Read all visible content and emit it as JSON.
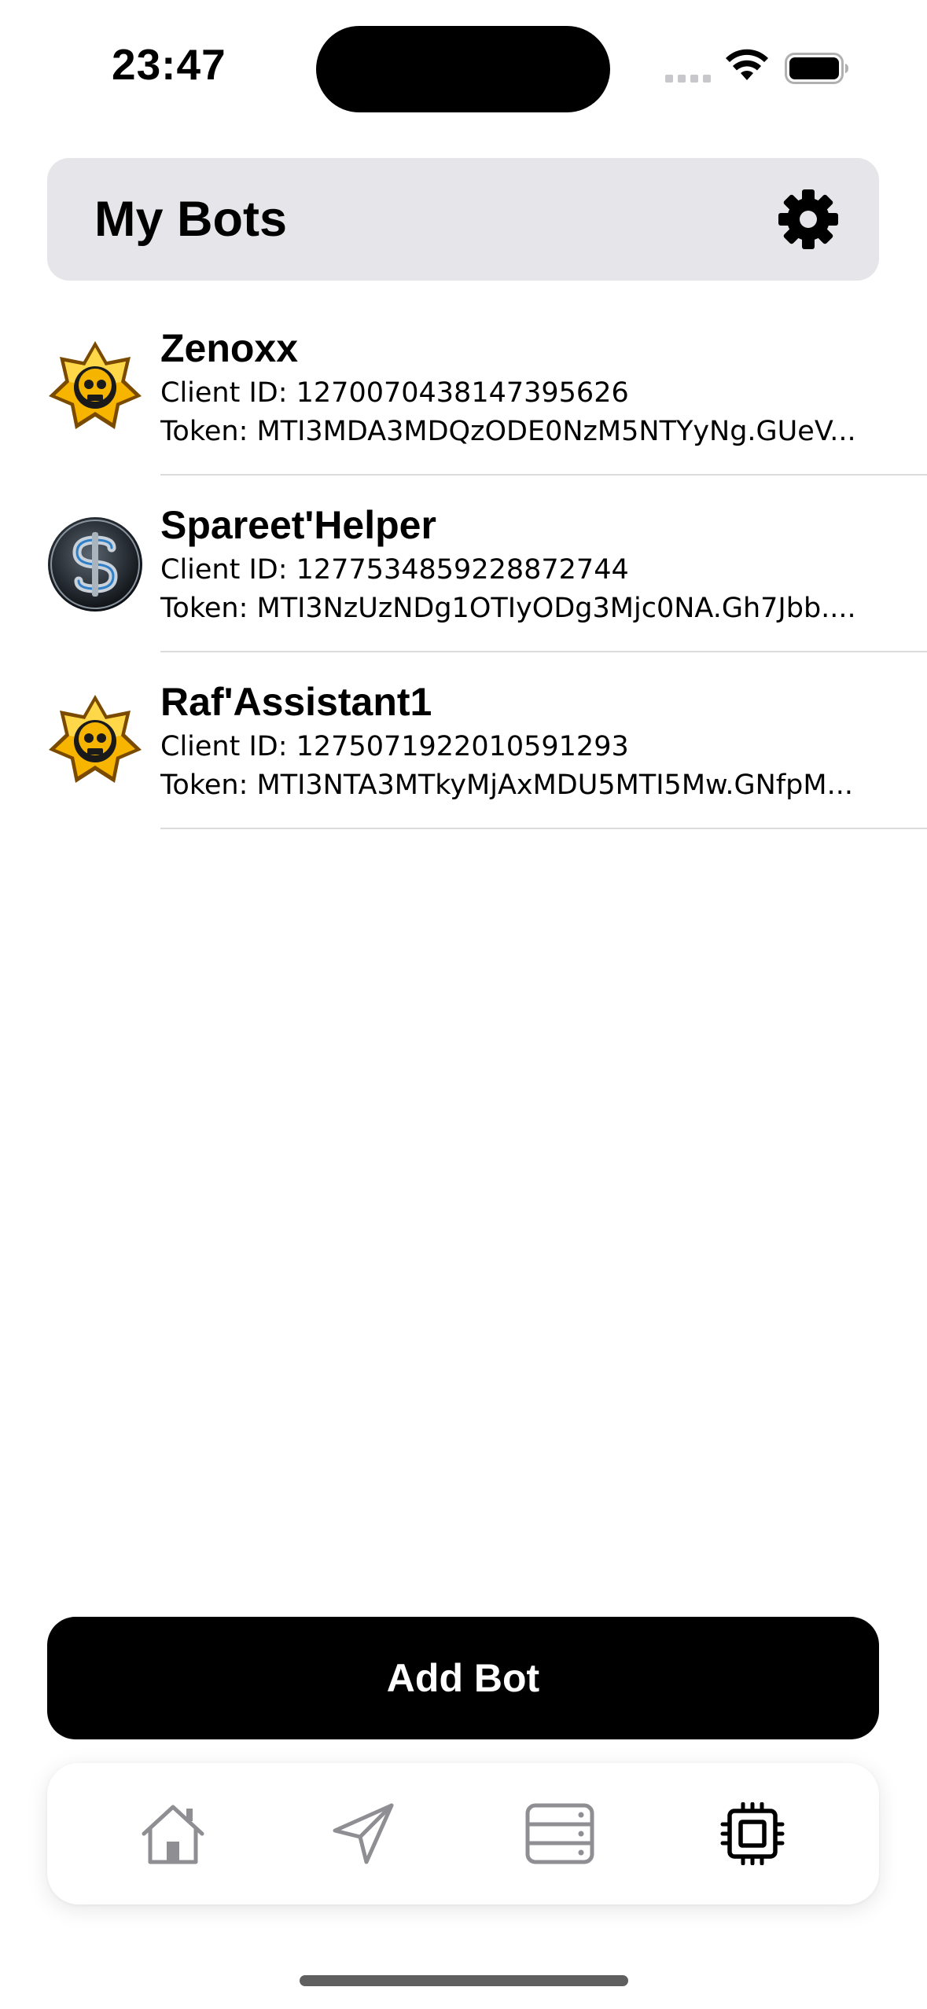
{
  "status_bar": {
    "time": "23:47"
  },
  "header": {
    "title": "My Bots",
    "settings_icon": "gear-icon"
  },
  "bots": [
    {
      "name": "Zenoxx",
      "client_id": "Client ID: 1270070438147395626",
      "token": "Token: MTI3MDA3MDQzODE0NzM5NTYyNg.GUeV...",
      "avatar": "brawl-star-skull-avatar"
    },
    {
      "name": "Spareet'Helper",
      "client_id": "Client ID: 1277534859228872744",
      "token": "Token: MTI3NzUzNDg1OTIyODg3Mjc0NA.Gh7Jbb....",
      "avatar": "metallic-s-logo-avatar"
    },
    {
      "name": "Raf'Assistant1",
      "client_id": "Client ID: 1275071922010591293",
      "token": "Token: MTI3NTA3MTkyMjAxMDU5MTI5Mw.GNfpM...",
      "avatar": "brawl-star-skull-avatar"
    }
  ],
  "add_button": {
    "label": "Add Bot"
  },
  "tab_bar": {
    "tabs": [
      {
        "icon": "home-icon",
        "selected": false
      },
      {
        "icon": "send-icon",
        "selected": false
      },
      {
        "icon": "server-icon",
        "selected": false
      },
      {
        "icon": "cpu-chip-icon",
        "selected": true
      }
    ]
  },
  "colors": {
    "header_bg": "#e5e5ea",
    "primary": "#000000",
    "tab_inactive": "#8e8e93",
    "divider": "#dcdcdf"
  }
}
